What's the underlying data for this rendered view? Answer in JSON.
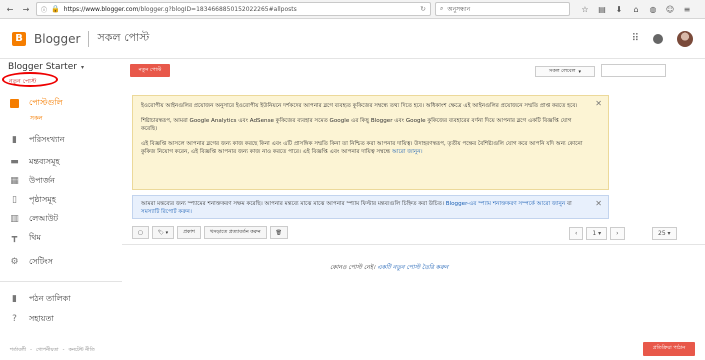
{
  "browser": {
    "url_host": "https://www.blogger.com",
    "url_path": "/blogger.g?blogID=1834668850152022265#allposts",
    "search_placeholder": "অনুসন্ধান",
    "back": "←",
    "forward": "→",
    "reload": "↻",
    "lock": "🔒",
    "info": "ⓘ",
    "reader_icon": "☆"
  },
  "header": {
    "logo_letter": "B",
    "app_name": "Blogger",
    "page_title": "সকল পোস্ট"
  },
  "sidebar": {
    "blog_name": "Blogger Starter",
    "caret": "▾",
    "new_post_link": "নতুন পোস্ট",
    "items": [
      {
        "label": "পোস্টগুলি",
        "icon": "posts-icon",
        "glyph": "▤"
      },
      {
        "label": "পরিসংখ্যান",
        "icon": "stats-icon",
        "glyph": "▮"
      },
      {
        "label": "মন্তব্যসমূহ",
        "icon": "comments-icon",
        "glyph": "▬"
      },
      {
        "label": "উপার্জন",
        "icon": "earnings-icon",
        "glyph": "▦"
      },
      {
        "label": "পৃষ্ঠাসমূহ",
        "icon": "pages-icon",
        "glyph": "▯"
      },
      {
        "label": "লেআউট",
        "icon": "layout-icon",
        "glyph": "▥"
      },
      {
        "label": "থিম",
        "icon": "theme-icon",
        "glyph": "┳"
      },
      {
        "label": "সেটিংস",
        "icon": "settings-icon",
        "glyph": "⚙"
      },
      {
        "label": "পঠন তালিকা",
        "icon": "reading-list-icon",
        "glyph": "▮"
      },
      {
        "label": "সহায়তা",
        "icon": "help-icon",
        "glyph": "?"
      }
    ],
    "sub_item": "সকল",
    "footer": [
      "শর্তাবলী",
      "গোপনীয়তা",
      "কনটেন্ট নীতি"
    ]
  },
  "main": {
    "new_post_button": "নতুন পোস্ট",
    "all_labels": "সকল লেবেল",
    "notice1": {
      "p1": "ইওরোপীয় আইনগুলির প্রয়োজন অনুসারে ইওরোপীয় ইউনিয়নে দর্শকদের আপনার ব্লগে ব্যবহৃত কুকিজের সম্বন্ধে তথ্য দিতে হবে। অধিকাংশ ক্ষেত্রে এই আইনগুলির প্রয়োজনে সম্মতি প্রাপ্ত করতে হবে।",
      "p2": "শিষ্টাচারস্বরূপ, আমরা Google Analytics এবং AdSense কুকিজের ব্যবহার সমেত Google এর কিছু Blogger এবং Google কুকিজের ব্যবহারের বর্ণনা দিয়ে আপনার ব্লগে একটি বিজ্ঞপ্তি যোগ করেছি।",
      "p3": "এই বিজ্ঞপ্তি আসলে আপনার ব্লগের জন্য কাজ করছে কিনা এবং এটি প্রাসঙ্গিক সম্মতি কিনা তা নিশ্চিত করা আপনার দায়িত্ব। উদাহরণস্বরূপ, তৃতীয় পক্ষের বৈশিষ্ট্যগুলি যোগ করে আপনি যদি অন্য কোনো কুকিজ নিয়োগ করেন, এই বিজ্ঞপ্তি আপনার জন্য কাজ নাও করতে পারে। এই বিজ্ঞপ্তি এবং আপনার দায়িত্ব সম্বন্ধে",
      "p3_link": "আরো জানুন।"
    },
    "notice2": {
      "text": "আমরা মন্তব্যের জন্য স্প্যামের শনাক্তকরণ সক্ষম করেছি। আপনার মন্তব্যে মাঝে মাঝে আপনার স্প্যাম ফিল্টার মন্তব্যগুলি চিহ্নিত করা উচিত।",
      "link1": "Blogger-এর স্প্যাম শনাক্তকরণ সম্পর্কে আরো জানুন",
      "mid": "বা",
      "link2": "সমস্যাটি রিপোর্ট করুন।"
    },
    "close": "✕",
    "toolbar": {
      "checkbox_icon": "▢",
      "label_button": "🏷 ▾",
      "publish": "প্রকাশ",
      "revert_draft": "খসড়াতে প্রত্যাবর্তন করুন",
      "delete_icon": "🗑"
    },
    "pager": {
      "prev": "‹",
      "page": "1 ▾",
      "next": "›",
      "rows": "25 ▾"
    },
    "empty_text": "কোনও পোস্ট নেই।",
    "empty_link": "একটি নতুন পোস্ট তৈরি করুন",
    "feedback": "প্রতিক্রিয়া পাঠান"
  }
}
